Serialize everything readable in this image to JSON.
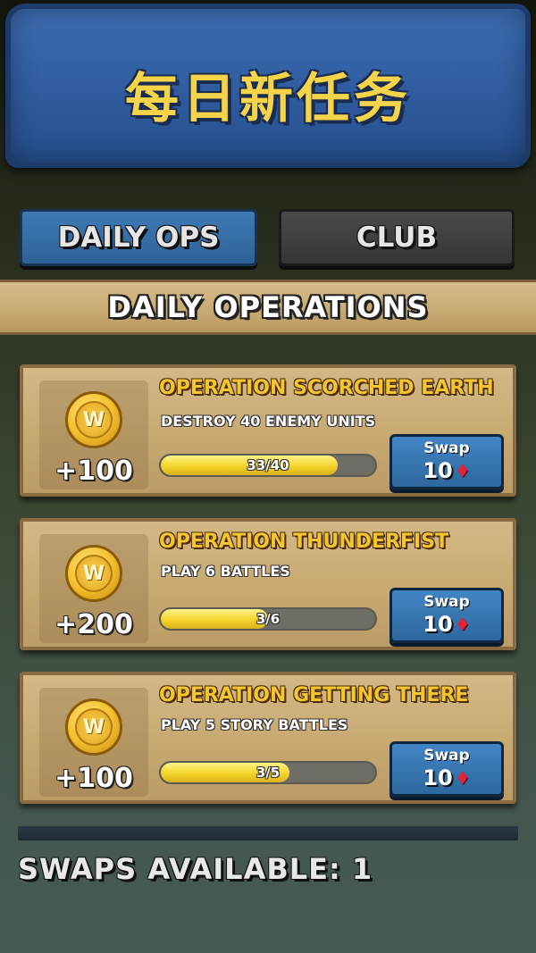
{
  "header": {
    "title": "每日新任务"
  },
  "tabs": [
    {
      "label": "DAILY OPS",
      "active": true
    },
    {
      "label": "CLUB",
      "active": false
    }
  ],
  "section": {
    "title": "DAILY OPERATIONS"
  },
  "missions": [
    {
      "name": "OPERATION SCORCHED EARTH",
      "description": "DESTROY 40 ENEMY UNITS",
      "reward": "+100",
      "coin_glyph": "W",
      "progress_text": "33/40",
      "progress_fraction": 0.825,
      "swap_label": "Swap",
      "swap_cost": "10"
    },
    {
      "name": "OPERATION THUNDERFIST",
      "description": "PLAY 6 BATTLES",
      "reward": "+200",
      "coin_glyph": "W",
      "progress_text": "3/6",
      "progress_fraction": 0.5,
      "swap_label": "Swap",
      "swap_cost": "10"
    },
    {
      "name": "OPERATION GETTING THERE",
      "description": "PLAY 5 STORY BATTLES",
      "reward": "+100",
      "coin_glyph": "W",
      "progress_text": "3/5",
      "progress_fraction": 0.6,
      "swap_label": "Swap",
      "swap_cost": "10"
    }
  ],
  "footer": {
    "swaps_available": "SWAPS AVAILABLE: 1"
  },
  "icons": {
    "coin": "w-coin-icon",
    "gem": "red-gem-icon"
  },
  "colors": {
    "accent_gold": "#f4c52e",
    "button_blue": "#3574b0",
    "progress_yellow": "#f5d32a"
  }
}
